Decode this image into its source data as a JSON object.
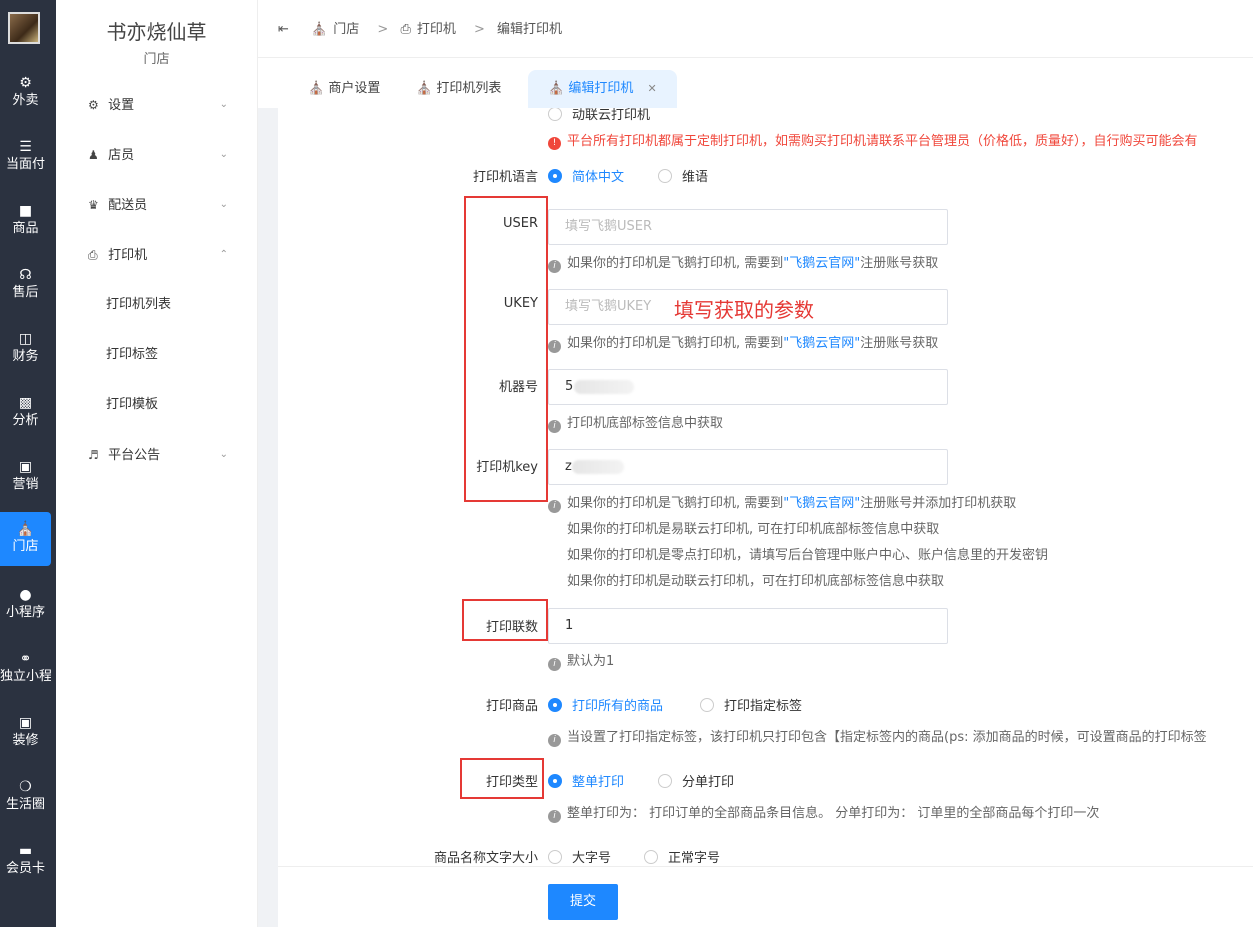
{
  "rail": {
    "items": [
      {
        "label": "外卖",
        "icon": "delivery-icon"
      },
      {
        "label": "当面付",
        "icon": "list-icon"
      },
      {
        "label": "商品",
        "icon": "product-icon"
      },
      {
        "label": "售后",
        "icon": "headset-icon"
      },
      {
        "label": "财务",
        "icon": "finance-icon"
      },
      {
        "label": "分析",
        "icon": "chart-icon"
      },
      {
        "label": "营销",
        "icon": "gift-icon"
      },
      {
        "label": "门店",
        "icon": "store-icon",
        "active": true
      },
      {
        "label": "小程序",
        "icon": "wechat-icon"
      },
      {
        "label": "独立小程序",
        "icon": "link-icon"
      },
      {
        "label": "装修",
        "icon": "decor-icon"
      },
      {
        "label": "生活圈",
        "icon": "circle-icon"
      },
      {
        "label": "会员卡",
        "icon": "card-icon"
      }
    ]
  },
  "sidebar": {
    "brand": "书亦烧仙草",
    "sub": "门店",
    "items": [
      {
        "label": "设置"
      },
      {
        "label": "店员"
      },
      {
        "label": "配送员"
      },
      {
        "label": "打印机"
      },
      {
        "label": "打印机列表"
      },
      {
        "label": "打印标签"
      },
      {
        "label": "打印模板"
      },
      {
        "label": "平台公告"
      }
    ]
  },
  "breadcrumb": {
    "items": [
      "门店",
      "打印机",
      "编辑打印机"
    ]
  },
  "tabs": [
    {
      "label": "商户设置"
    },
    {
      "label": "打印机列表"
    },
    {
      "label": "编辑打印机",
      "active": true
    }
  ],
  "form": {
    "top_option": "动联云打印机",
    "warning": "平台所有打印机都属于定制打印机，如需购买打印机请联系平台管理员（价格低，质量好），自行购买可能会有",
    "lang_label": "打印机语言",
    "lang_opt1": "简体中文",
    "lang_opt2": "维语",
    "user_label": "USER",
    "user_placeholder": "填写飞鹅USER",
    "user_hint_pre": "如果你的打印机是飞鹅打印机, 需要到",
    "user_hint_link": "\"飞鹅云官网\"",
    "user_hint_post": "注册账号获取",
    "ukey_label": "UKEY",
    "ukey_placeholder": "填写飞鹅UKEY",
    "ukey_hint_pre": "如果你的打印机是飞鹅打印机, 需要到",
    "ukey_hint_link": "\"飞鹅云官网\"",
    "ukey_hint_post": "注册账号获取",
    "annotation": "填写获取的参数",
    "sn_label": "机器号",
    "sn_value": "5",
    "sn_hint": "打印机底部标签信息中获取",
    "key_label": "打印机key",
    "key_value": "z",
    "key_hint_pre": "如果你的打印机是飞鹅打印机, 需要到",
    "key_hint_link": "\"飞鹅云官网\"",
    "key_hint_post": "注册账号并添加打印机获取",
    "key_hint2": "如果你的打印机是易联云打印机, 可在打印机底部标签信息中获取",
    "key_hint3": "如果你的打印机是零点打印机，请填写后台管理中账户中心、账户信息里的开发密钥",
    "key_hint4": "如果你的打印机是动联云打印机，可在打印机底部标签信息中获取",
    "copies_label": "打印联数",
    "copies_value": "1",
    "copies_hint": "默认为1",
    "goods_label": "打印商品",
    "goods_opt1": "打印所有的商品",
    "goods_opt2": "打印指定标签",
    "goods_hint": "当设置了打印指定标签，该打印机只打印包含【指定标签内的商品(ps: 添加商品的时候，可设置商品的打印标签",
    "type_label": "打印类型",
    "type_opt1": "整单打印",
    "type_opt2": "分单打印",
    "type_hint": "整单打印为：  打印订单的全部商品条目信息。  分单打印为：  订单里的全部商品每个打印一次",
    "font_label": "商品名称文字大小",
    "font_opt1": "大字号",
    "font_opt2": "正常字号",
    "submit": "提交"
  }
}
